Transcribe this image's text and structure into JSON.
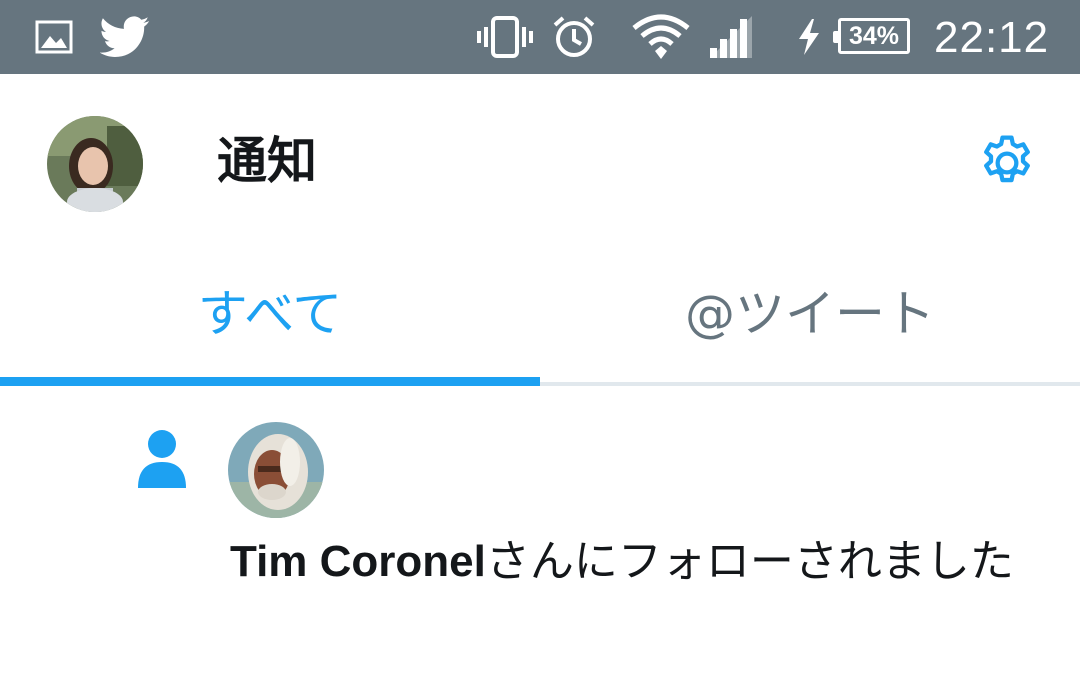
{
  "status_bar": {
    "left_icons": [
      "image-icon",
      "twitter-bird-icon"
    ],
    "right_icons": [
      "vibrate-icon",
      "alarm-icon",
      "wifi-icon",
      "signal-icon",
      "charging-icon"
    ],
    "battery_percent": "34%",
    "time": "22:12"
  },
  "header": {
    "title": "通知",
    "avatar_icon": "profile-avatar",
    "settings_icon": "gear-icon"
  },
  "tabs": [
    {
      "label": "すべて",
      "active": true
    },
    {
      "label": "@ツイート",
      "active": false
    }
  ],
  "notifications": [
    {
      "type_icon": "person-icon",
      "avatar_icon": "follower-avatar",
      "name": "Tim Coronel",
      "message": "さんにフォローされました"
    }
  ],
  "colors": {
    "status_bar": "#66757f",
    "accent": "#1da1f2",
    "inactive_tab": "#66757f",
    "text": "#14171a"
  }
}
